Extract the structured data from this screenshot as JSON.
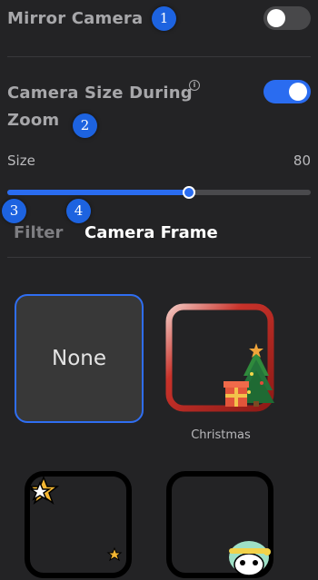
{
  "mirror_camera": {
    "label": "Mirror Camera",
    "enabled": false
  },
  "camera_size_during_zoom": {
    "label_line1": "Camera Size During",
    "label_line2": "Zoom",
    "info_glyph": "i",
    "enabled": true
  },
  "size": {
    "label": "Size",
    "value": "80",
    "fraction": 0.6
  },
  "tabs": [
    {
      "label": "Filter",
      "active": false
    },
    {
      "label": "Camera Frame",
      "active": true
    }
  ],
  "frames": [
    {
      "label": "None",
      "caption": "",
      "selected": true
    },
    {
      "label": "",
      "caption": "Christmas",
      "selected": false
    },
    {
      "label": "",
      "caption": "",
      "selected": false
    },
    {
      "label": "",
      "caption": "",
      "selected": false
    }
  ],
  "annotations": [
    "1",
    "2",
    "3",
    "4"
  ],
  "colors": {
    "background": "#232325",
    "accent": "#2a6cf0",
    "toggle_off": "#48484a",
    "badge": "#1d63e0"
  }
}
